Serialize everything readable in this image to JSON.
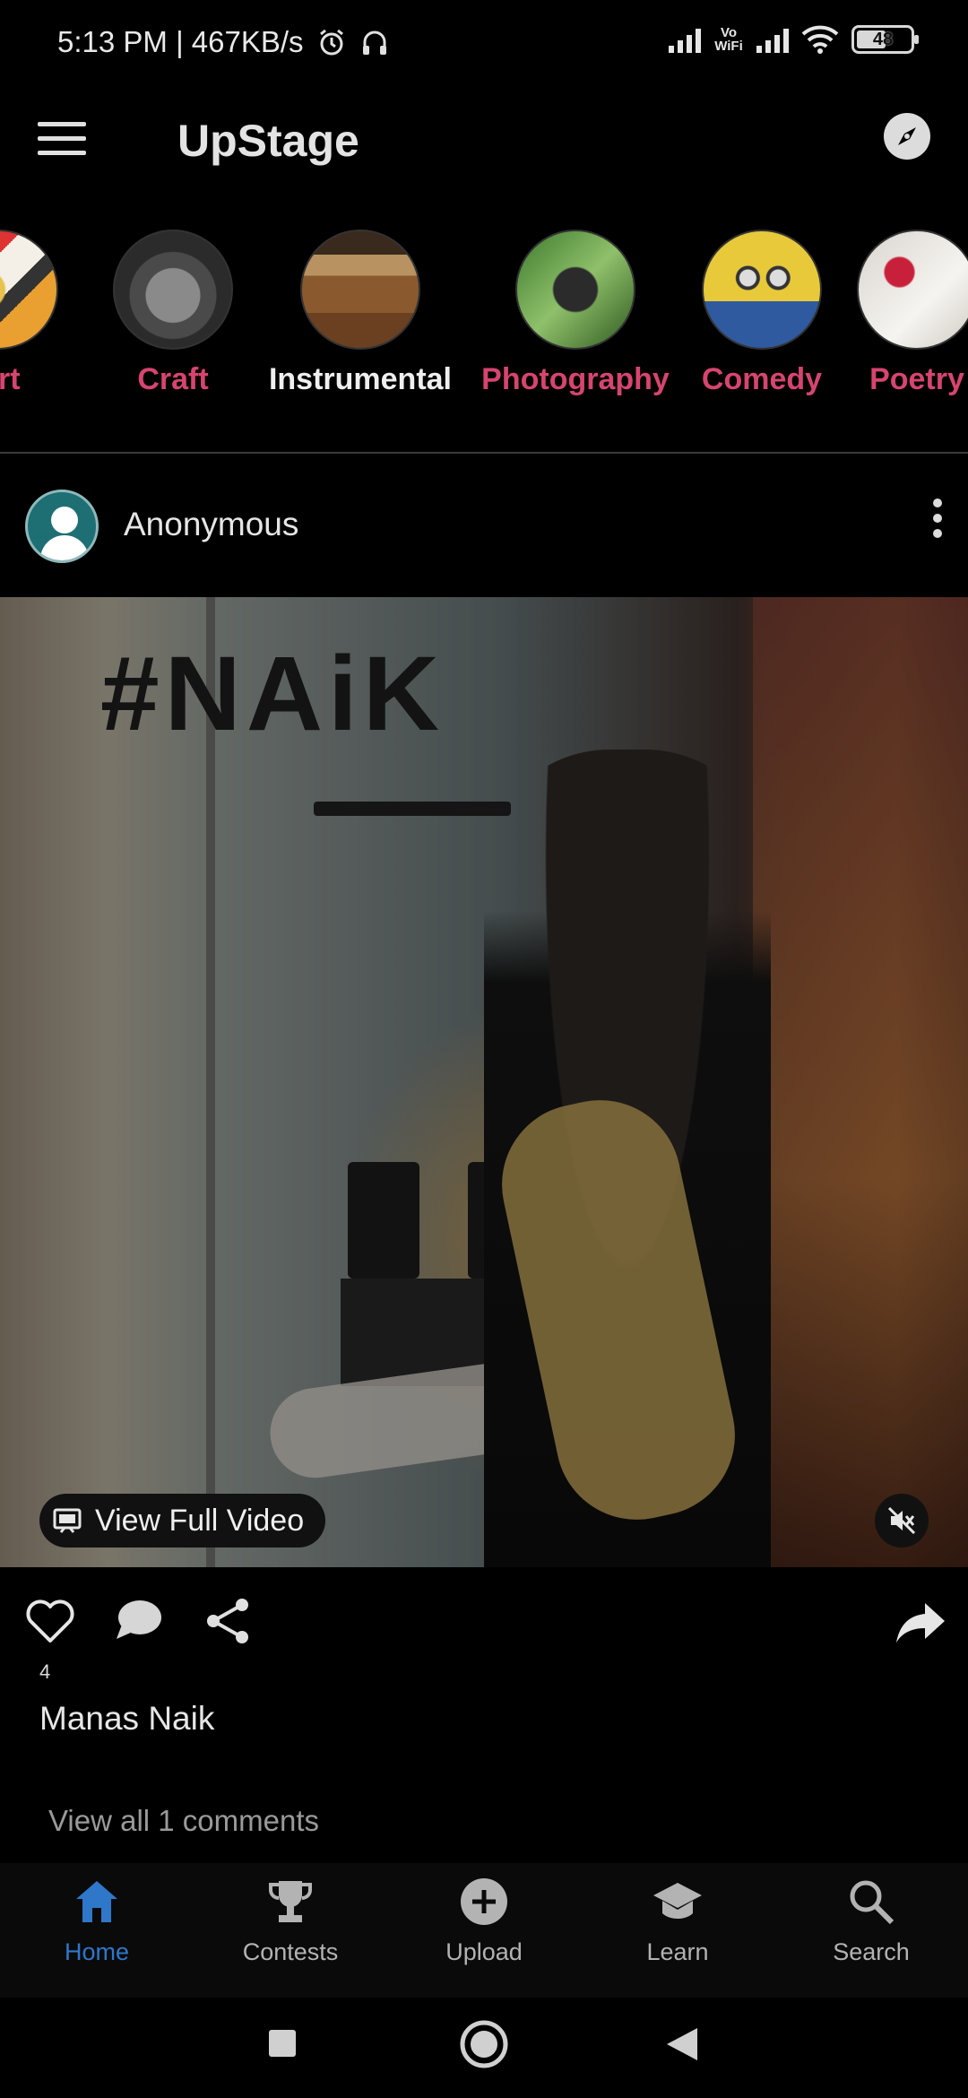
{
  "status_bar": {
    "time": "5:13 PM | 467KB/s",
    "vowifi": "Vo WiFi",
    "battery": "48"
  },
  "app_bar": {
    "title": "UpStage",
    "menu_icon": "hamburger-menu-icon",
    "compass_icon": "compass-icon"
  },
  "categories": [
    {
      "label": "Art",
      "selected": false
    },
    {
      "label": "Craft",
      "selected": false
    },
    {
      "label": "Instrumental",
      "selected": true
    },
    {
      "label": "Photography",
      "selected": false
    },
    {
      "label": "Comedy",
      "selected": false
    },
    {
      "label": "Poetry",
      "selected": false
    }
  ],
  "post": {
    "author": "Anonymous",
    "video_overlay_text": "#NAiK",
    "view_full_label": "View Full Video",
    "like_count": "4",
    "caption": "Manas Naik",
    "view_comments": "View all 1 comments"
  },
  "bottom_nav": [
    {
      "label": "Home",
      "icon": "home-icon",
      "active": true
    },
    {
      "label": "Contests",
      "icon": "trophy-icon",
      "active": false
    },
    {
      "label": "Upload",
      "icon": "add-circle-icon",
      "active": false
    },
    {
      "label": "Learn",
      "icon": "school-icon",
      "active": false
    },
    {
      "label": "Search",
      "icon": "search-icon",
      "active": false
    }
  ],
  "colors": {
    "accent_pink": "#d6456f",
    "active_blue": "#2f77c9",
    "background": "#000000"
  }
}
